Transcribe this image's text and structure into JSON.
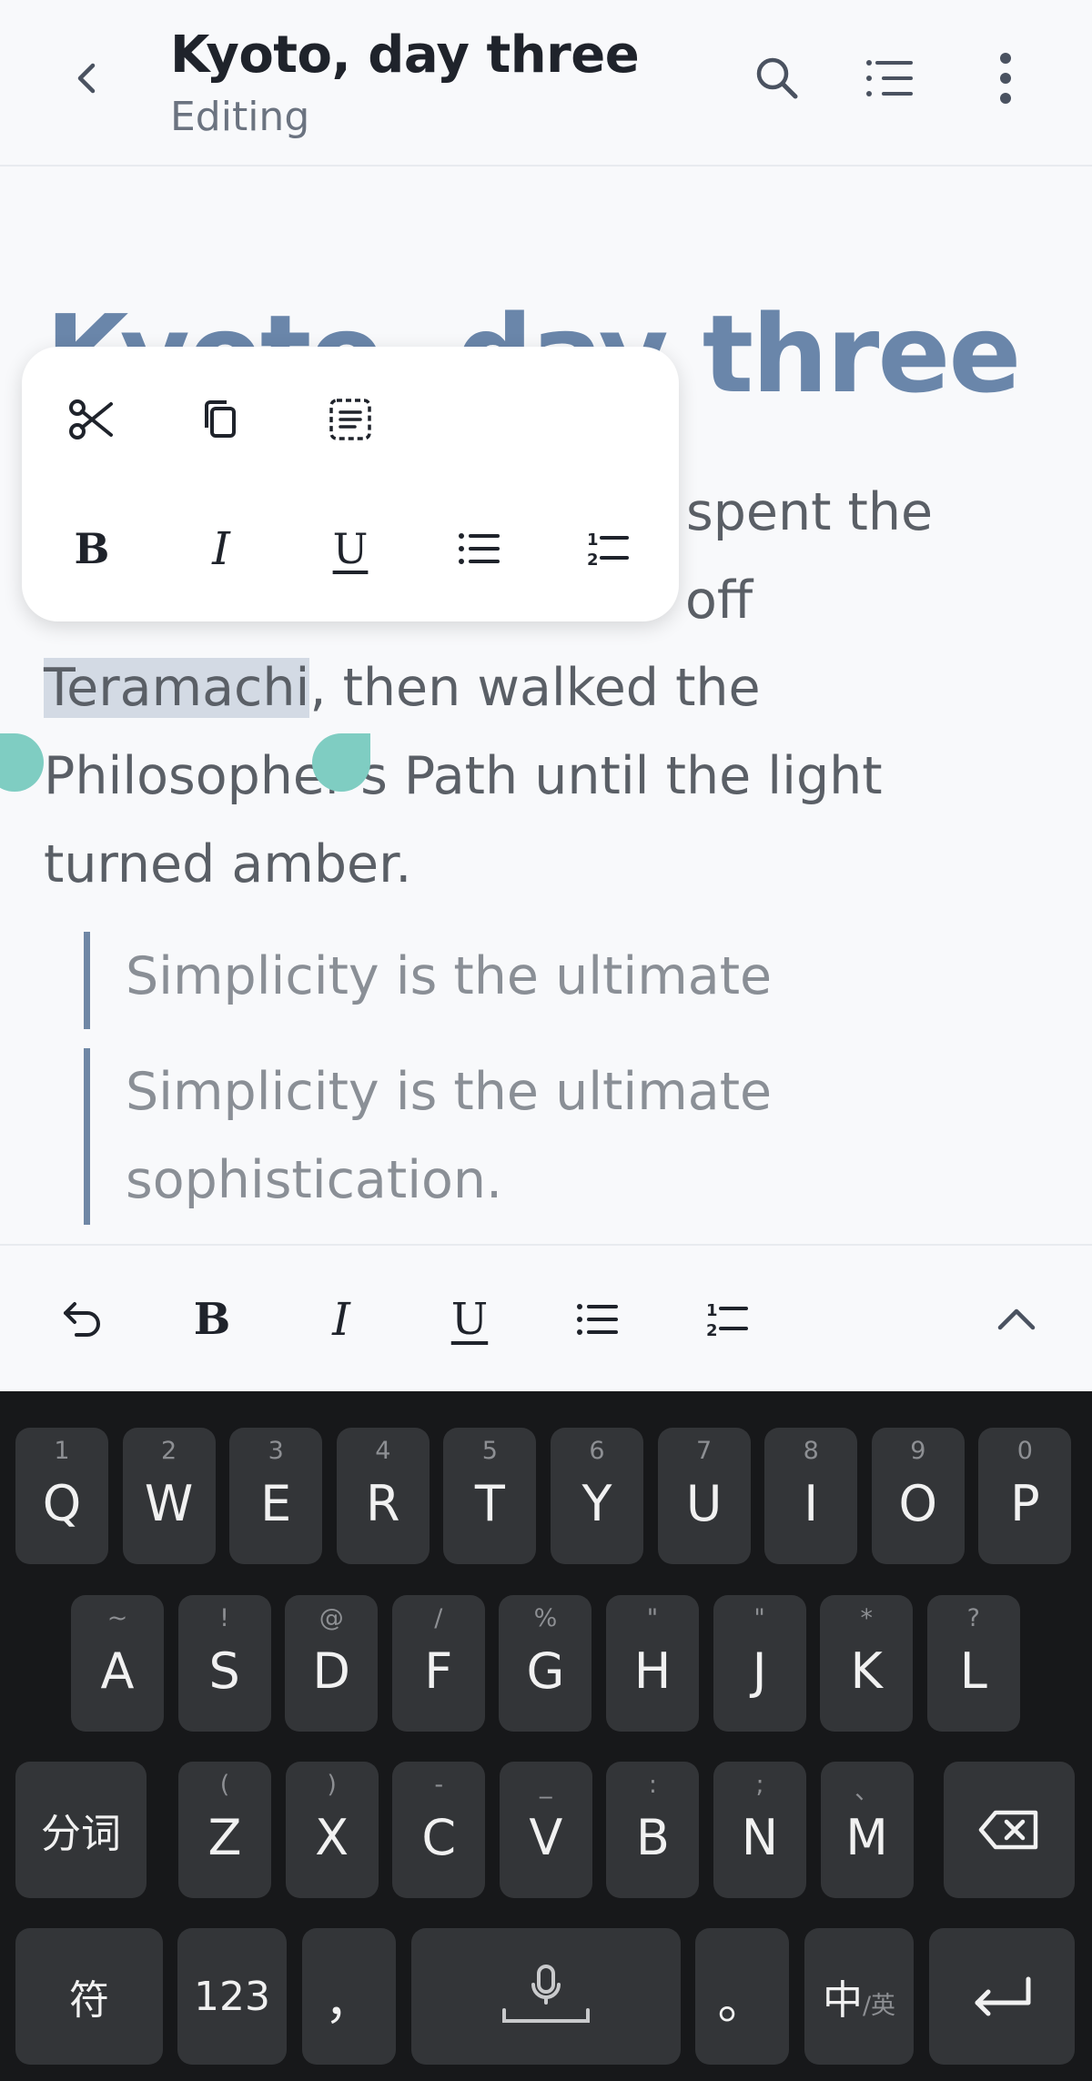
{
  "header": {
    "title": "Kyoto, day three",
    "subtitle": "Editing",
    "icons": [
      "back-arrow-icon",
      "search-icon",
      "outline-icon",
      "more-vertical-icon"
    ]
  },
  "document": {
    "heading": "Kyoto, day three",
    "paragraph": {
      "line1_tail": "spent the",
      "line2_tail": "off",
      "line3_selected": "Teramachi",
      "line3_rest": ", then walked the",
      "line4": "Philosopher's Path until the light",
      "line5": "turned amber."
    },
    "quotes": [
      {
        "text": "Simplicity is the ultimate"
      },
      {
        "line1": "Simplicity is the ultimate",
        "line2": "sophistication."
      }
    ]
  },
  "selection_popup": {
    "row1": [
      "cut-icon",
      "copy-icon",
      "select-all-icon"
    ],
    "row2": {
      "bold": "B",
      "italic": "I",
      "underline": "U",
      "bullet_list": "bullet-list-icon",
      "numbered_list": "numbered-list-icon"
    }
  },
  "format_toolbar": {
    "undo": "undo-icon",
    "bold": "B",
    "italic": "I",
    "underline": "U",
    "bullet_list": "bullet-list-icon",
    "numbered_list": "numbered-list-icon",
    "collapse": "chevron-up-icon"
  },
  "keyboard": {
    "row1": [
      {
        "key": "Q",
        "hint": "1"
      },
      {
        "key": "W",
        "hint": "2"
      },
      {
        "key": "E",
        "hint": "3"
      },
      {
        "key": "R",
        "hint": "4"
      },
      {
        "key": "T",
        "hint": "5"
      },
      {
        "key": "Y",
        "hint": "6"
      },
      {
        "key": "U",
        "hint": "7"
      },
      {
        "key": "I",
        "hint": "8"
      },
      {
        "key": "O",
        "hint": "9"
      },
      {
        "key": "P",
        "hint": "0"
      }
    ],
    "row2": [
      {
        "key": "A",
        "hint": "~"
      },
      {
        "key": "S",
        "hint": "!"
      },
      {
        "key": "D",
        "hint": "@"
      },
      {
        "key": "F",
        "hint": "/"
      },
      {
        "key": "G",
        "hint": "%"
      },
      {
        "key": "H",
        "hint": "\""
      },
      {
        "key": "J",
        "hint": "\""
      },
      {
        "key": "K",
        "hint": "*"
      },
      {
        "key": "L",
        "hint": "?"
      }
    ],
    "row3": {
      "left": "分词",
      "keys": [
        {
          "key": "Z",
          "hint": "("
        },
        {
          "key": "X",
          "hint": ")"
        },
        {
          "key": "C",
          "hint": "-"
        },
        {
          "key": "V",
          "hint": "_"
        },
        {
          "key": "B",
          "hint": ":"
        },
        {
          "key": "N",
          "hint": ";"
        },
        {
          "key": "M",
          "hint": "、"
        }
      ]
    },
    "row4": {
      "symbols": "符",
      "numbers": "123",
      "comma": "，",
      "period": "。",
      "lang_main": "中",
      "lang_sub": "/英"
    }
  }
}
